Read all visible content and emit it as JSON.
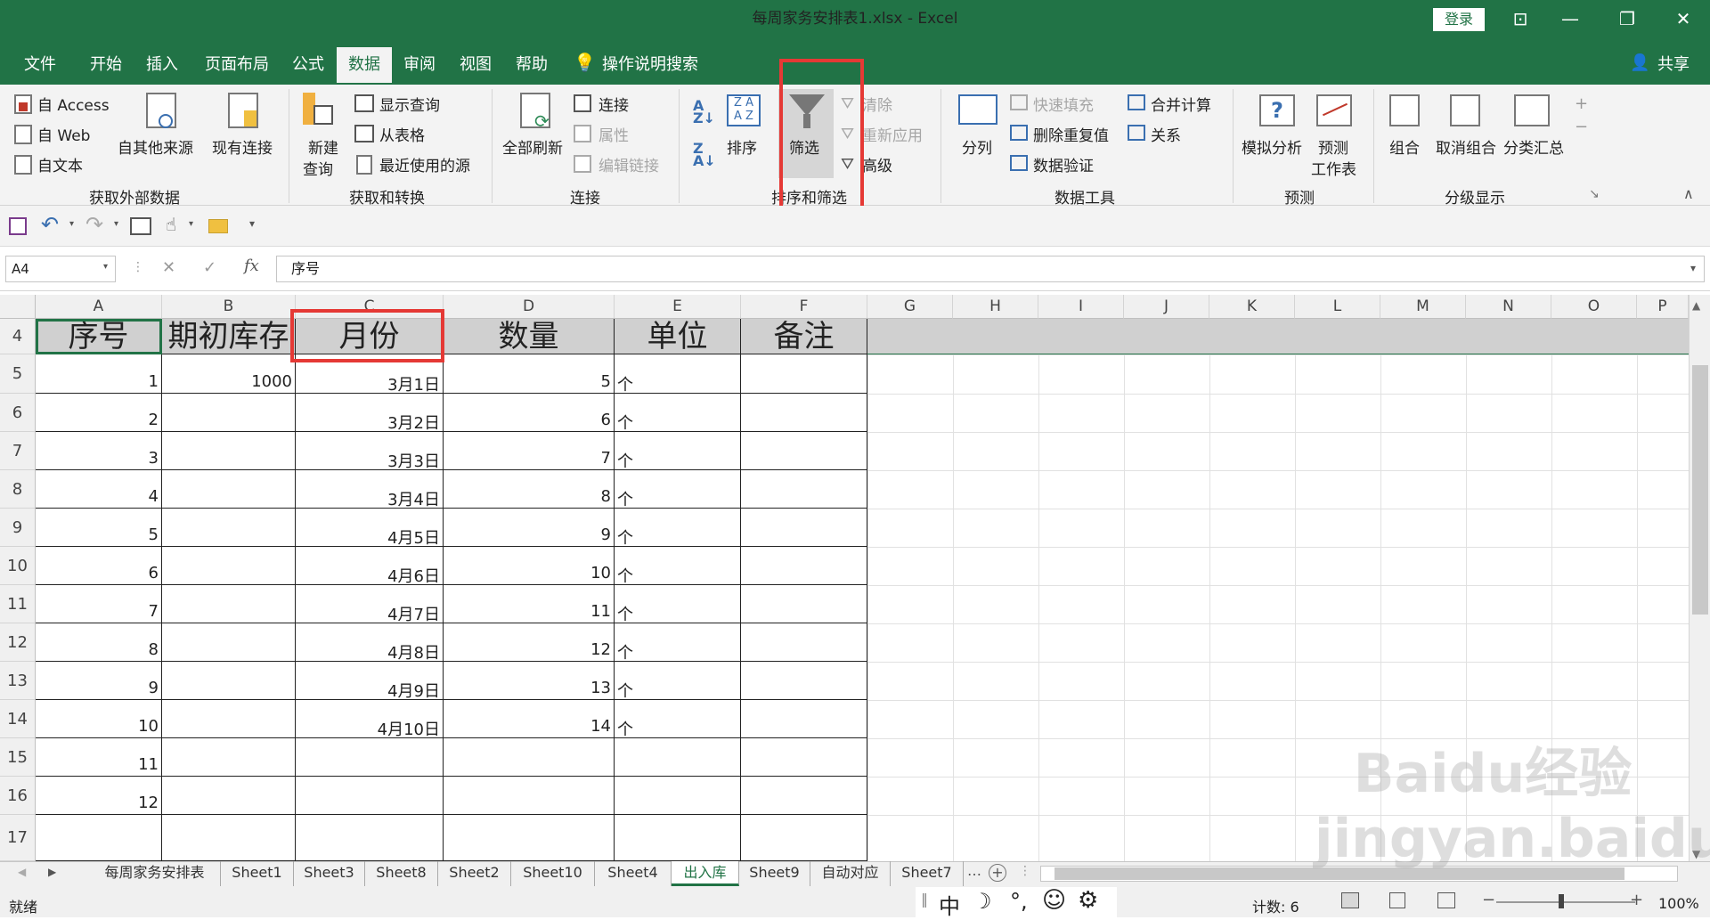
{
  "window": {
    "title": "每周家务安排表1.xlsx  -  Excel",
    "login": "登录"
  },
  "tabs": [
    "文件",
    "开始",
    "插入",
    "页面布局",
    "公式",
    "数据",
    "审阅",
    "视图",
    "帮助"
  ],
  "tellme": "操作说明搜索",
  "share": "共享",
  "ribbon": {
    "g1": {
      "access": "自 Access",
      "web": "自 Web",
      "text": "自文本",
      "other": "自其他来源",
      "existing": "现有连接",
      "label": "获取外部数据"
    },
    "g2": {
      "newq1": "新建",
      "newq2": "查询",
      "show": "显示查询",
      "table": "从表格",
      "recent": "最近使用的源",
      "label": "获取和转换"
    },
    "g3": {
      "refresh": "全部刷新",
      "conn": "连接",
      "prop": "属性",
      "edit": "编辑链接",
      "label": "连接"
    },
    "g4": {
      "sort": "排序",
      "filter": "筛选",
      "clear": "清除",
      "reapply": "重新应用",
      "adv": "高级",
      "label": "排序和筛选"
    },
    "g5": {
      "split": "分列",
      "flash": "快速填充",
      "dup": "删除重复值",
      "valid": "数据验证",
      "merge": "合并计算",
      "rel": "关系",
      "label": "数据工具"
    },
    "g6": {
      "whatif": "模拟分析",
      "fc1": "预测",
      "fc2": "工作表",
      "label": "预测"
    },
    "g7": {
      "group": "组合",
      "ungroup": "取消组合",
      "subtotal": "分类汇总",
      "label": "分级显示"
    }
  },
  "formula": {
    "namebox": "A4",
    "content": "序号",
    "fx": "fx"
  },
  "columns": [
    "A",
    "B",
    "C",
    "D",
    "E",
    "F",
    "G",
    "H",
    "I",
    "J",
    "K",
    "L",
    "M",
    "N",
    "O",
    "P"
  ],
  "rownums": [
    "4",
    "5",
    "6",
    "7",
    "8",
    "9",
    "10",
    "11",
    "12",
    "13",
    "14",
    "15",
    "16",
    "17"
  ],
  "headers": [
    "序号",
    "期初库存",
    "月份",
    "数量",
    "单位",
    "备注"
  ],
  "rows": [
    [
      "1",
      "1000",
      "3月1日",
      "5",
      "个",
      ""
    ],
    [
      "2",
      "",
      "3月2日",
      "6",
      "个",
      ""
    ],
    [
      "3",
      "",
      "3月3日",
      "7",
      "个",
      ""
    ],
    [
      "4",
      "",
      "3月4日",
      "8",
      "个",
      ""
    ],
    [
      "5",
      "",
      "4月5日",
      "9",
      "个",
      ""
    ],
    [
      "6",
      "",
      "4月6日",
      "10",
      "个",
      ""
    ],
    [
      "7",
      "",
      "4月7日",
      "11",
      "个",
      ""
    ],
    [
      "8",
      "",
      "4月8日",
      "12",
      "个",
      ""
    ],
    [
      "9",
      "",
      "4月9日",
      "13",
      "个",
      ""
    ],
    [
      "10",
      "",
      "4月10日",
      "14",
      "个",
      ""
    ],
    [
      "11",
      "",
      "",
      "",
      "",
      ""
    ],
    [
      "12",
      "",
      "",
      "",
      "",
      ""
    ],
    [
      "",
      "",
      "",
      "",
      "",
      ""
    ]
  ],
  "sheets": [
    "每周家务安排表",
    "Sheet1",
    "Sheet3",
    "Sheet8",
    "Sheet2",
    "Sheet10",
    "Sheet4",
    "出入库",
    "Sheet9",
    "自动对应",
    "Sheet7"
  ],
  "status": {
    "ready": "就绪",
    "count": "计数: 6",
    "zoom": "100%",
    "ime": "中"
  },
  "watermark": "Baidu经验 jingyan.baidu.com"
}
